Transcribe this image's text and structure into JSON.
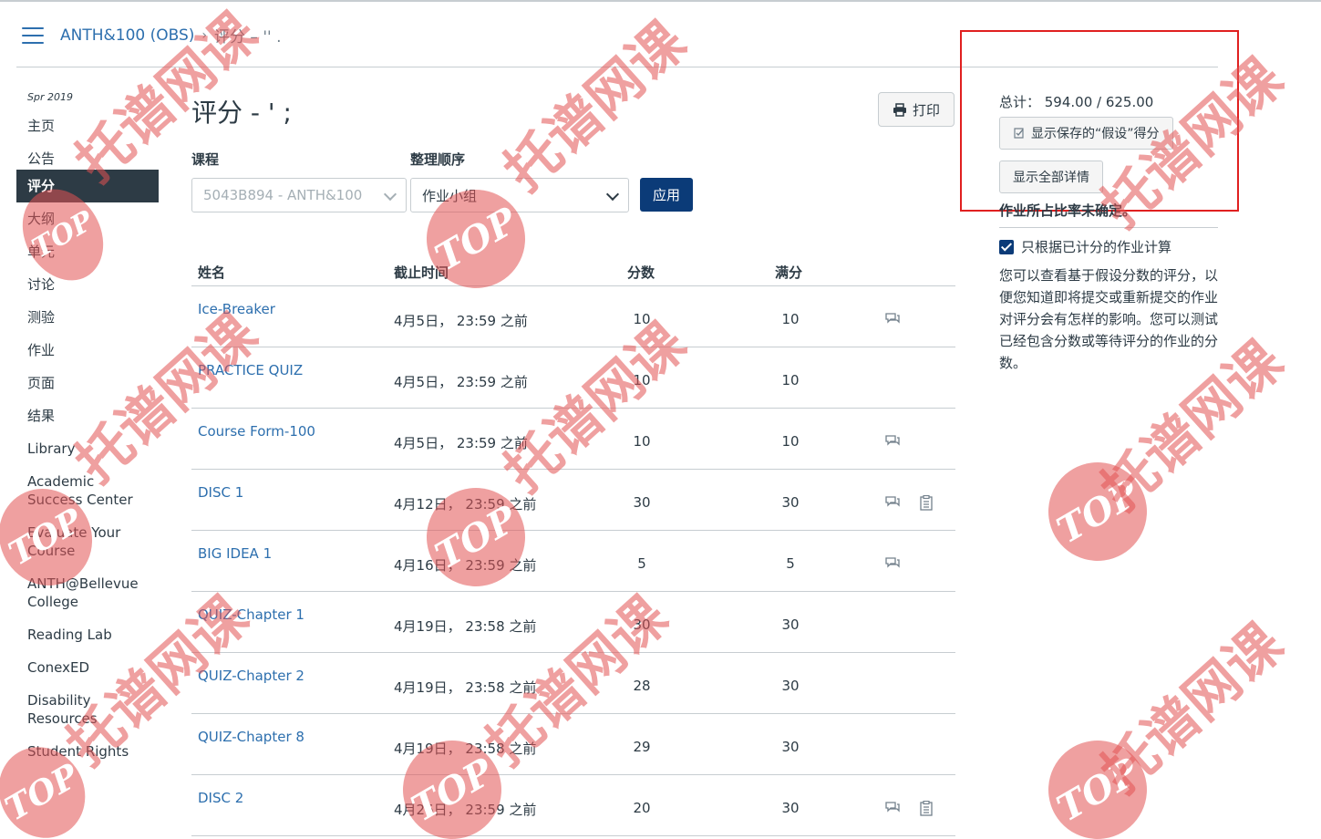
{
  "breadcrumb": {
    "course": "ANTH&100 (OBS)",
    "separator": "›",
    "current": "评分 – '' ."
  },
  "nav": {
    "term": "Spr 2019",
    "items": [
      "主页",
      "公告",
      "评分",
      "大纲",
      "单元",
      "讨论",
      "测验",
      "作业",
      "页面",
      "结果",
      "Library",
      "Academic Success Center",
      "Evaluate Your Course",
      "ANTH@Bellevue College",
      "Reading Lab",
      "ConexED",
      "Disability Resources",
      "Student Rights"
    ],
    "active_index": 2
  },
  "page": {
    "title": "评分 - ' ;",
    "print_label": "打印"
  },
  "filters": {
    "course_label": "课程",
    "course_value": "5043B894 - ANTH&100",
    "order_label": "整理顺序",
    "order_value": "作业小组",
    "apply_label": "应用"
  },
  "table": {
    "headers": {
      "name": "姓名",
      "due": "截止时间",
      "score": "分数",
      "out_of": "满分"
    },
    "rows": [
      {
        "name": "Ice-Breaker",
        "due": "4月5日， 23:59 之前",
        "score": "10",
        "out_of": "10",
        "comment": true,
        "rubric": false
      },
      {
        "name": "PRACTICE QUIZ",
        "due": "4月5日， 23:59 之前",
        "score": "10",
        "out_of": "10",
        "comment": false,
        "rubric": false
      },
      {
        "name": "Course Form-100",
        "due": "4月5日， 23:59 之前",
        "score": "10",
        "out_of": "10",
        "comment": true,
        "rubric": false
      },
      {
        "name": "DISC 1",
        "due": "4月12日， 23:59 之前",
        "score": "30",
        "out_of": "30",
        "comment": true,
        "rubric": true
      },
      {
        "name": "BIG IDEA 1",
        "due": "4月16日， 23:59 之前",
        "score": "5",
        "out_of": "5",
        "comment": true,
        "rubric": false
      },
      {
        "name": "QUIZ-Chapter 1",
        "due": "4月19日， 23:58 之前",
        "score": "30",
        "out_of": "30",
        "comment": false,
        "rubric": false
      },
      {
        "name": "QUIZ-Chapter 2",
        "due": "4月19日， 23:58 之前",
        "score": "28",
        "out_of": "30",
        "comment": false,
        "rubric": false
      },
      {
        "name": "QUIZ-Chapter 8",
        "due": "4月19日， 23:58 之前",
        "score": "29",
        "out_of": "30",
        "comment": false,
        "rubric": false
      },
      {
        "name": "DISC 2",
        "due": "4月26日， 23:59 之前",
        "score": "20",
        "out_of": "30",
        "comment": true,
        "rubric": true
      }
    ]
  },
  "sidebar": {
    "total": "总计： 594.00 / 625.00",
    "what_if_button": "显示保存的“假设”得分",
    "show_all_button": "显示全部详情",
    "weights_heading": "作业所占比率未确定。",
    "checkbox_label": "只根据已计分的作业计算",
    "checkbox_checked": true,
    "description": "您可以查看基于假设分数的评分，以便您知道即将提交或重新提交的作业对评分会有怎样的影响。您可以测试已经包含分数或等待评分的作业的分数。"
  },
  "watermark": {
    "logo_text": "TOP",
    "text": "托谱网课",
    "color": "#e25252"
  }
}
